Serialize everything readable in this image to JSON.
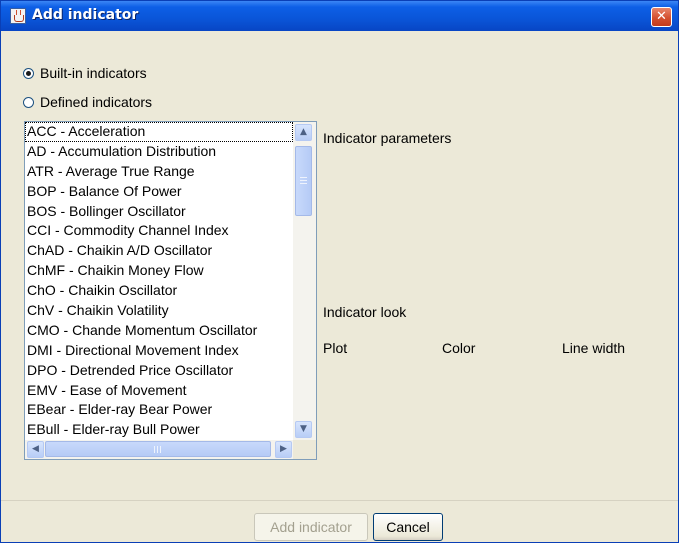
{
  "window": {
    "title": "Add indicator",
    "close_glyph": "✕"
  },
  "source": {
    "options": [
      {
        "label": "Built-in indicators",
        "selected": true
      },
      {
        "label": "Defined indicators",
        "selected": false
      }
    ]
  },
  "indicators": {
    "items": [
      "ACC - Acceleration",
      "AD - Accumulation Distribution",
      "ATR - Average True Range",
      "BOP - Balance Of Power",
      "BOS - Bollinger Oscillator",
      "CCI - Commodity Channel Index",
      "ChAD - Chaikin A/D Oscillator",
      "ChMF - Chaikin Money Flow",
      "ChO - Chaikin Oscillator",
      "ChV - Chaikin Volatility",
      "CMO - Chande Momentum Oscillator",
      "DMI - Directional Movement Index",
      "DPO - Detrended Price Oscillator",
      "EMV - Ease of Movement",
      "EBear - Elder-ray Bear Power",
      "EBull - Elder-ray Bull Power"
    ],
    "focused_index": 0,
    "scroll": {
      "up_glyph": "▲",
      "down_glyph": "▼",
      "left_glyph": "◀",
      "right_glyph": "▶"
    }
  },
  "parameters": {
    "heading": "Indicator parameters"
  },
  "look": {
    "heading": "Indicator look",
    "columns": [
      "Plot",
      "Color",
      "Line width"
    ]
  },
  "buttons": {
    "add_label": "Add indicator",
    "add_enabled": false,
    "cancel_label": "Cancel"
  },
  "icons": {
    "app": "java-cup-icon",
    "close": "close-icon",
    "radio": "radio-icon"
  },
  "colors": {
    "title_bar": "#0a55d8",
    "dialog_bg": "#ece9d8",
    "close_button": "#d4502f",
    "list_border": "#7f9db9",
    "scrollbar_thumb": "#b5cbf6"
  }
}
